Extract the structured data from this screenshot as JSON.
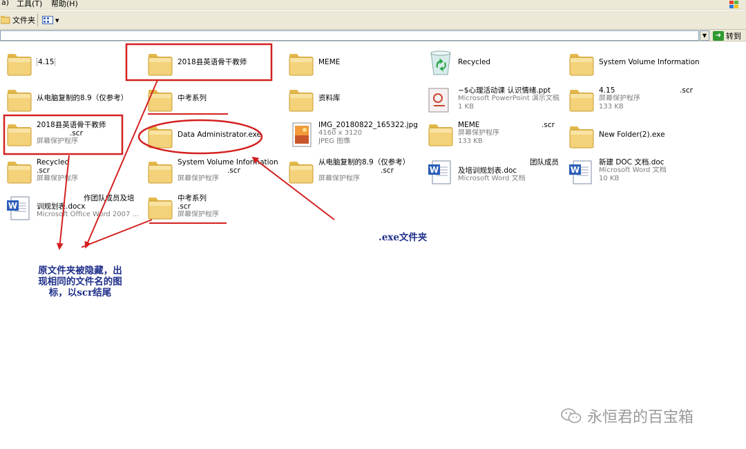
{
  "menubar": {
    "items": [
      "a)",
      "工具(T)",
      "帮助(H)"
    ]
  },
  "toolbar": {
    "folders_label": "文件夹",
    "view_menu_arrow": "▾"
  },
  "address": {
    "value": "",
    "go_label": "转到"
  },
  "files": [
    {
      "id": "f1",
      "icon": "folder-icon",
      "name": "4.15",
      "sub": "",
      "ext": ""
    },
    {
      "id": "f2",
      "icon": "folder-icon",
      "name": "从电脑复制的8.9（仅参考）",
      "sub": "",
      "ext": ""
    },
    {
      "id": "f3",
      "icon": "folder-icon",
      "name": "2018县英语骨干教师",
      "ext": ".scr",
      "sub": "屏幕保护程序"
    },
    {
      "id": "f4",
      "icon": "folder-icon",
      "name": "Recycled",
      "ext": ".scr",
      "sub": "屏幕保护程序"
    },
    {
      "id": "f5",
      "icon": "word-doc-icon",
      "name": "作团队成员及培",
      "ext": "",
      "sub": "训规划表.docx",
      "sub2": "Microsoft Office Word 2007 ..."
    },
    {
      "id": "f6",
      "icon": "folder-icon",
      "name": "2018县英语骨干教师",
      "sub": "",
      "ext": ""
    },
    {
      "id": "f7",
      "icon": "folder-icon",
      "name": "中考系列",
      "sub": "",
      "ext": ""
    },
    {
      "id": "f8",
      "icon": "folder-icon",
      "name": "Data Administrator.exe",
      "sub": "",
      "ext": ""
    },
    {
      "id": "f9",
      "icon": "folder-icon",
      "name": "System Volume Information",
      "ext": ".scr",
      "sub": "屏幕保护程序"
    },
    {
      "id": "f10",
      "icon": "folder-icon",
      "name": "中考系列",
      "ext": ".scr",
      "sub": "屏幕保护程序"
    },
    {
      "id": "f11",
      "icon": "folder-icon",
      "name": "MEME",
      "sub": "",
      "ext": ""
    },
    {
      "id": "f12",
      "icon": "folder-icon",
      "name": "资料库",
      "sub": "",
      "ext": ""
    },
    {
      "id": "f13",
      "icon": "jpeg-image-icon",
      "name": "IMG_20180822_165322.jpg",
      "sub": "4160 x 3120",
      "sub2": "JPEG 图像"
    },
    {
      "id": "f14",
      "icon": "folder-icon",
      "name": "从电脑复制的8.9（仅参考）",
      "ext": ".scr",
      "sub": "屏幕保护程序"
    },
    {
      "id": "f15",
      "icon": "recycle-bin-icon",
      "name": "Recycled",
      "sub": "",
      "ext": ""
    },
    {
      "id": "f16",
      "icon": "ppt-icon",
      "name": "~$心理活动课 认识情绪.ppt",
      "sub": "Microsoft PowerPoint 演示文稿",
      "sub2": "1 KB"
    },
    {
      "id": "f17",
      "icon": "folder-icon",
      "name": "MEME",
      "ext": ".scr",
      "sub": "屏幕保护程序",
      "sub2": "133 KB"
    },
    {
      "id": "f18",
      "icon": "word-doc-icon",
      "name": "团队成员",
      "sub": "及培训规划表.doc",
      "sub2": "Microsoft Word 文档"
    },
    {
      "id": "f19",
      "icon": "folder-icon",
      "name": "System Volume Information",
      "sub": "",
      "ext": ""
    },
    {
      "id": "f20",
      "icon": "folder-icon",
      "name": "4.15",
      "ext": ".scr",
      "sub": "屏幕保护程序",
      "sub2": "133 KB"
    },
    {
      "id": "f21",
      "icon": "folder-icon",
      "name": "New Folder(2).exe",
      "sub": "",
      "ext": ""
    },
    {
      "id": "f22",
      "icon": "word-doc-icon",
      "name": "新建 DOC 文档.doc",
      "sub": "Microsoft Word 文档",
      "sub2": "10 KB"
    }
  ],
  "annotations": {
    "exe_note": ".exe文件夹",
    "hidden_note_line1": "原文件夹被隐藏，出",
    "hidden_note_line2": "现相同的文件名的图",
    "hidden_note_line3": "标，以scr结尾"
  },
  "watermark": {
    "text": "永恒君的百宝箱"
  },
  "colors": {
    "annotation_red": "#d42020",
    "note_blue": "#1f2f8a",
    "folder_yellow": "#f5d77a"
  }
}
